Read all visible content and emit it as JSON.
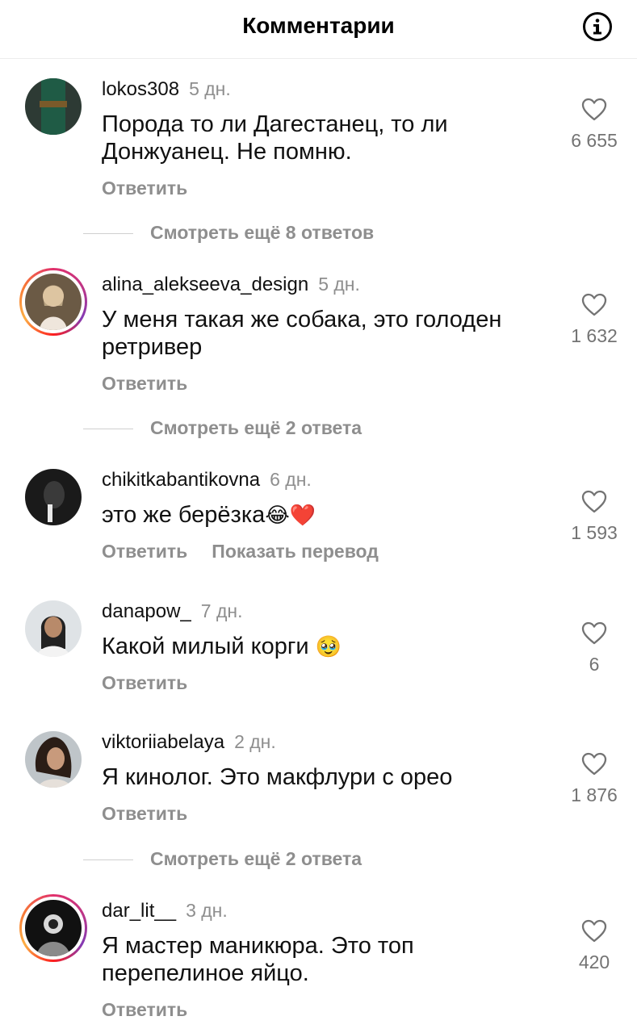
{
  "header": {
    "title": "Комментарии"
  },
  "comments": [
    {
      "username": "lokos308",
      "time": "5 дн.",
      "text": "Порода то ли Дагестанец, то ли Донжуанец. Не помню.",
      "likes": "6 655",
      "reply": "Ответить",
      "more": "Смотреть ещё 8 ответов",
      "avatar_icon": "avatar-photo"
    },
    {
      "username": "alina_alekseeva_design",
      "time": "5 дн.",
      "text": "У меня такая же собака, это голоден ретривер",
      "likes": "1 632",
      "reply": "Ответить",
      "more": "Смотреть ещё 2 ответа",
      "avatar_icon": "avatar-photo-story-ring"
    },
    {
      "username": "chikitkabantikovna",
      "time": "6 дн.",
      "text": "это же берёзка",
      "emoji": "😂❤️",
      "likes": "1 593",
      "reply": "Ответить",
      "translate": "Показать перевод",
      "avatar_icon": "avatar-photo"
    },
    {
      "username": "danapow_",
      "time": "7 дн.",
      "text": "Какой милый корги",
      "emoji": "🥹",
      "likes": "6",
      "reply": "Ответить",
      "avatar_icon": "avatar-photo"
    },
    {
      "username": "viktoriiabelaya",
      "time": "2 дн.",
      "text": "Я кинолог. Это макфлури с орео",
      "likes": "1 876",
      "reply": "Ответить",
      "more": "Смотреть ещё 2 ответа",
      "avatar_icon": "avatar-photo"
    },
    {
      "username": "dar_lit__",
      "time": "3 дн.",
      "text": "Я мастер маникюра. Это топ перепелиное яйцо.",
      "likes": "420",
      "reply": "Ответить",
      "avatar_icon": "avatar-photo-story-ring"
    }
  ],
  "icons": {
    "info": "info-circle-icon",
    "like": "heart-outline-icon"
  },
  "colors": {
    "muted": "#8e8e8e",
    "story_ring": "#e1306c"
  }
}
